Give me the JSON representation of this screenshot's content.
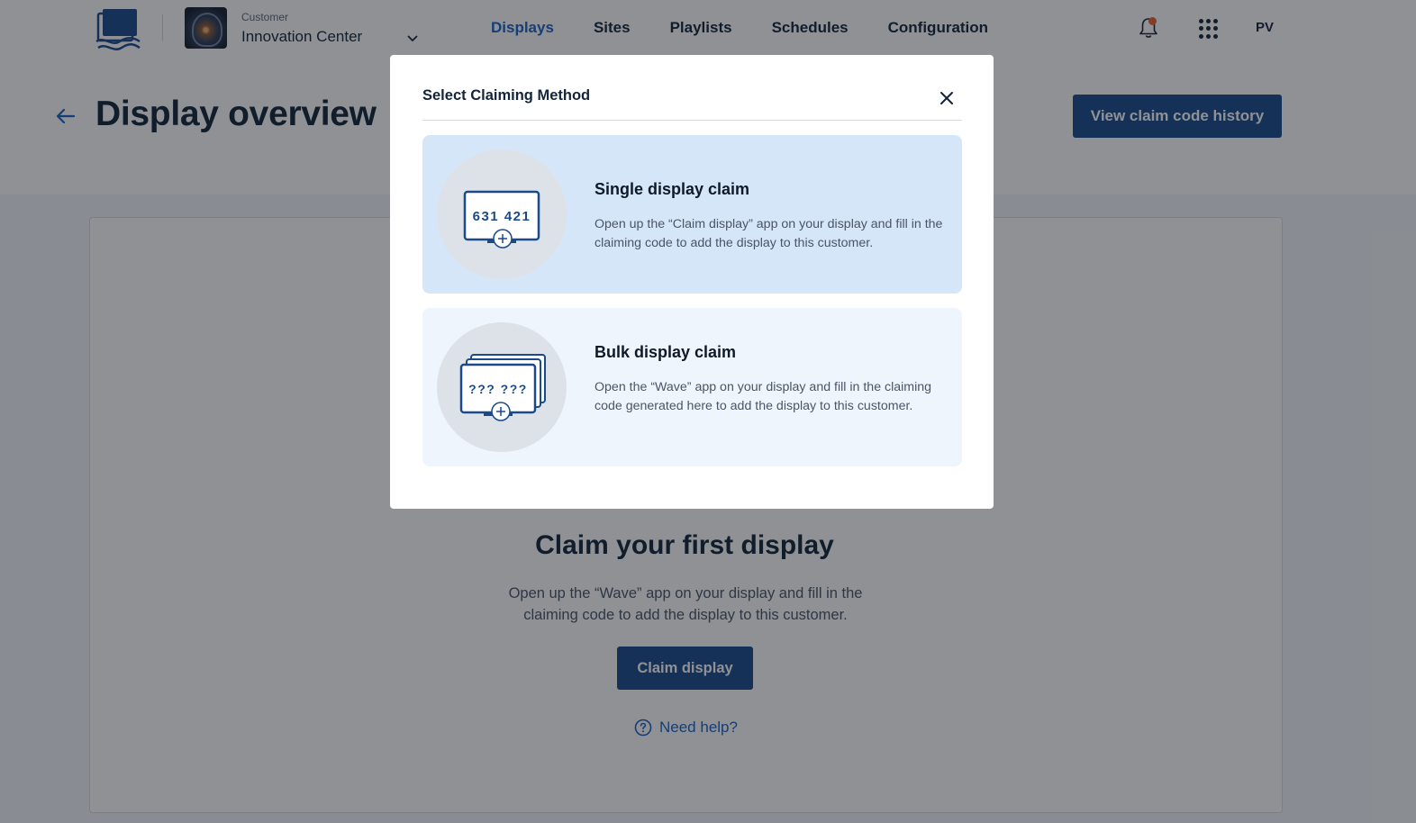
{
  "nav": {
    "customer_label": "Customer",
    "customer_name": "Innovation Center",
    "links": [
      "Displays",
      "Sites",
      "Playlists",
      "Schedules",
      "Configuration"
    ],
    "active_link": "Displays",
    "user_initials": "PV",
    "notification_badge_color": "#e8622c"
  },
  "header": {
    "title": "Display overview",
    "history_button": "View claim code history"
  },
  "empty_state": {
    "title": "Claim your first display",
    "description": "Open up the “Wave” app on your display and fill in the claiming code to add the display to this customer.",
    "button": "Claim display",
    "help_link": "Need help?"
  },
  "modal": {
    "title": "Select Claiming Method",
    "options": [
      {
        "title": "Single display claim",
        "description": "Open up the “Claim display” app on your display and fill in the claiming code to add the display to this customer.",
        "illustration_code": "631 421"
      },
      {
        "title": "Bulk display claim",
        "description": "Open the “Wave” app on your display and fill in the claiming code generated here to add the display to this customer.",
        "illustration_code": "??? ???"
      }
    ]
  },
  "colors": {
    "primary": "#1a4a8a",
    "link": "#1b62c4",
    "selected_option_bg": "#d5e6f8",
    "option_bg": "#eef5fd"
  }
}
